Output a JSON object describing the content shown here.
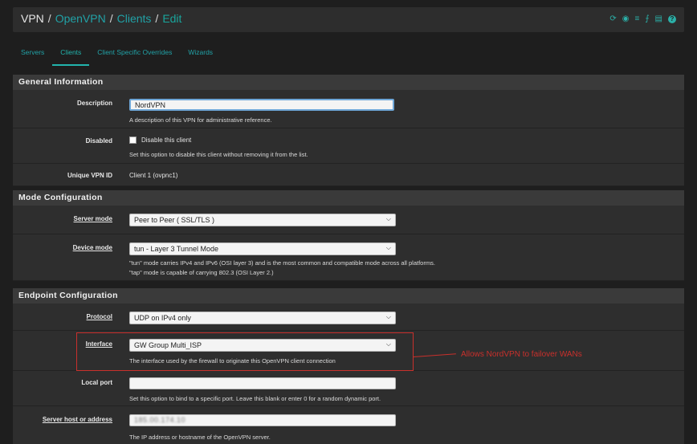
{
  "breadcrumb": {
    "root": "VPN",
    "level1": "OpenVPN",
    "level2": "Clients",
    "current": "Edit"
  },
  "toolbar_icons": [
    "reload-icon",
    "stop-icon",
    "sliders-icon",
    "chart-icon",
    "list-icon",
    "help-icon"
  ],
  "tabs": [
    "Servers",
    "Clients",
    "Client Specific Overrides",
    "Wizards"
  ],
  "active_tab": "Clients",
  "general": {
    "title": "General Information",
    "description_label": "Description",
    "description_value": "NordVPN",
    "description_help": "A description of this VPN for administrative reference.",
    "disabled_label": "Disabled",
    "disabled_checkbox_label": "Disable this client",
    "disabled_help": "Set this option to disable this client without removing it from the list.",
    "unique_id_label": "Unique VPN ID",
    "unique_id_value": "Client 1 (ovpnc1)"
  },
  "mode": {
    "title": "Mode Configuration",
    "server_mode_label": "Server mode",
    "server_mode_value": "Peer to Peer ( SSL/TLS )",
    "device_mode_label": "Device mode",
    "device_mode_value": "tun - Layer 3 Tunnel Mode",
    "device_mode_help1": "\"tun\" mode carries IPv4 and IPv6 (OSI layer 3) and is the most common and compatible mode across all platforms.",
    "device_mode_help2": "\"tap\" mode is capable of carrying 802.3 (OSI Layer 2.)"
  },
  "endpoint": {
    "title": "Endpoint Configuration",
    "protocol_label": "Protocol",
    "protocol_value": "UDP on IPv4 only",
    "interface_label": "Interface",
    "interface_value": "GW Group Multi_ISP",
    "interface_help": "The interface used by the firewall to originate this OpenVPN client connection",
    "local_port_label": "Local port",
    "local_port_value": "",
    "local_port_help": "Set this option to bind to a specific port. Leave this blank or enter 0 for a random dynamic port.",
    "server_host_label": "Server host or address",
    "server_host_value": "185.00.174.10",
    "server_host_help": "The IP address or hostname of the OpenVPN server."
  },
  "annotation": {
    "text": "Allows NordVPN to failover WANs",
    "color": "#c9302c"
  },
  "colors": {
    "accent": "#21a2a7",
    "background": "#1e1e1e",
    "row": "#2e2e2e",
    "header": "#3a3a3a"
  }
}
